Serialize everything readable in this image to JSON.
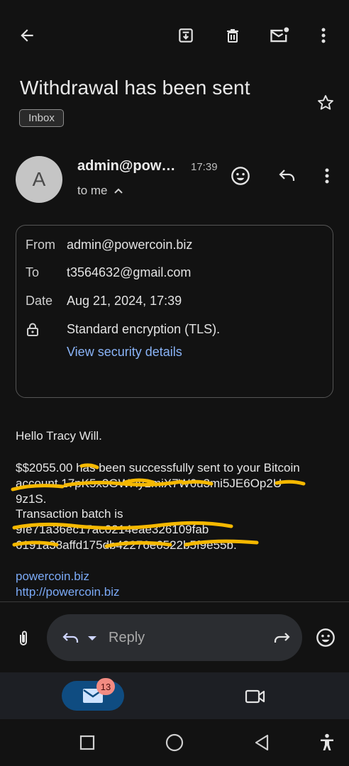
{
  "email": {
    "subject": "Withdrawal has been sent",
    "label": "Inbox",
    "sender_short": "admin@pow…",
    "time": "17:39",
    "to_me": "to me",
    "avatar_letter": "A"
  },
  "details": {
    "from_label": "From",
    "from_value": "admin@powercoin.biz",
    "to_label": "To",
    "to_value": "t3564632@gmail.com",
    "date_label": "Date",
    "date_value": "Aug 21, 2024, 17:39",
    "encryption": "Standard encryption (TLS).",
    "security_link": "View security details"
  },
  "body": {
    "greeting": "Hello Tracy Will.",
    "line1": "$$2055.00 has been successfully sent to your Bitcoin",
    "line2": "account 17pK5x3GWHy1miX7W6u3mi5JE6Op2U",
    "line3": "9z1S.",
    "line4": "Transaction batch is",
    "line5": "9fe71a36ec17ac0214eae326109fab",
    "line6": "6191a38affd175db42276e6522b5f9e55b.",
    "link1": "powercoin.biz",
    "link2": "http://powercoin.biz"
  },
  "reply": {
    "label": "Reply"
  },
  "nav": {
    "mail_count": "13"
  },
  "colors": {
    "background": "#121212",
    "link": "#8ab4f8",
    "mail_pill": "#0f4c81",
    "badge": "#f28b82",
    "scribble": "#f5b800"
  },
  "icons": [
    "back-arrow-icon",
    "archive-icon",
    "trash-icon",
    "mark-unread-icon",
    "more-vert-icon",
    "star-icon",
    "chevron-up-icon",
    "emoji-icon",
    "reply-icon",
    "lock-icon",
    "attachment-icon",
    "dropdown-icon",
    "forward-icon",
    "mail-icon",
    "video-icon",
    "square-icon",
    "circle-icon",
    "triangle-back-icon",
    "accessibility-icon"
  ]
}
